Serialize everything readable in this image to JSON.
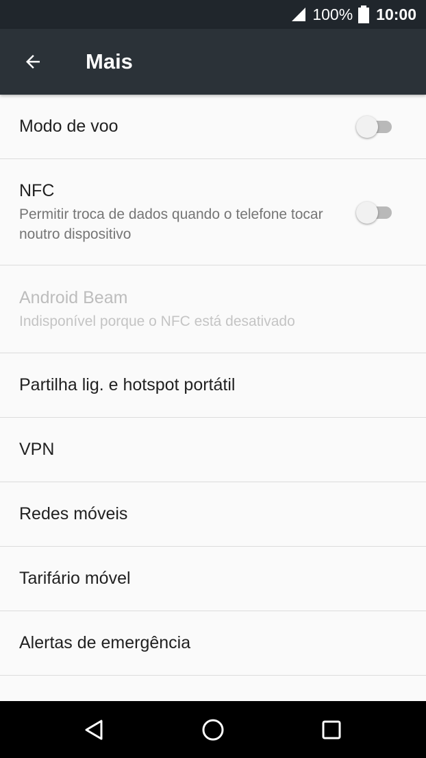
{
  "status_bar": {
    "battery_percent": "100%",
    "time": "10:00",
    "icons": [
      "signal-icon",
      "battery-icon"
    ]
  },
  "app_bar": {
    "title": "Mais",
    "back_icon": "arrow-back-icon"
  },
  "items": [
    {
      "title": "Modo de voo",
      "toggle": "off"
    },
    {
      "title": "NFC",
      "subtitle": "Permitir troca de dados quando o telefone tocar noutro dispositivo",
      "toggle": "off"
    },
    {
      "title": "Android Beam",
      "subtitle": "Indisponível porque o NFC está desativado",
      "disabled": true
    },
    {
      "title": "Partilha lig. e hotspot portátil"
    },
    {
      "title": "VPN"
    },
    {
      "title": "Redes móveis"
    },
    {
      "title": "Tarifário móvel"
    },
    {
      "title": "Alertas de emergência"
    }
  ],
  "nav_bar": {
    "buttons": [
      "back-triangle-icon",
      "home-circle-icon",
      "recents-square-icon"
    ]
  },
  "colors": {
    "status_bar": "#20262c",
    "app_bar": "#2b3238",
    "background": "#fafafa",
    "divider": "#dcdcdc"
  }
}
